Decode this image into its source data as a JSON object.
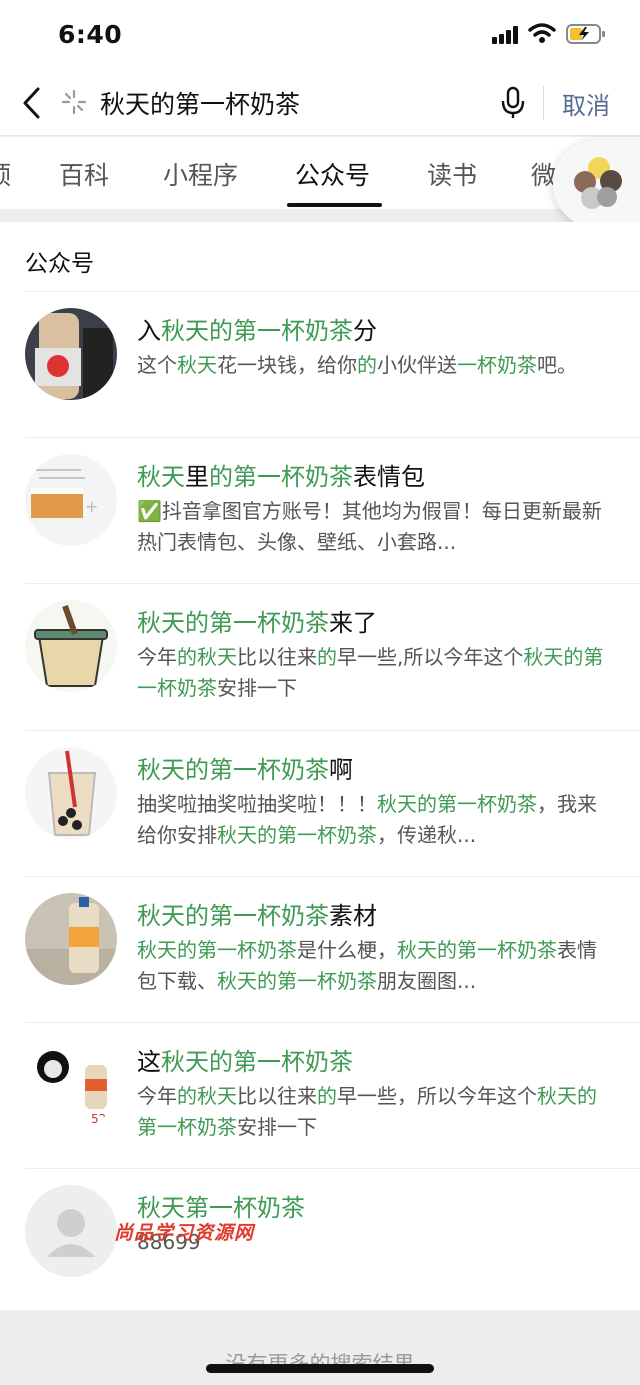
{
  "status": {
    "time": "6:40"
  },
  "search": {
    "query": "秋天的第一杯奶茶",
    "cancel": "取消"
  },
  "tabs": [
    "顶",
    "百科",
    "小程序",
    "公众号",
    "读书",
    "微"
  ],
  "active_tab": "公众号",
  "section_title": "公众号",
  "results": [
    {
      "title": [
        [
          "入",
          0
        ],
        [
          "秋天的第一杯奶茶",
          1
        ],
        [
          "分",
          0
        ]
      ],
      "desc": [
        [
          "这个",
          0
        ],
        [
          "秋天",
          1
        ],
        [
          "花一块钱，给你",
          0
        ],
        [
          "的",
          1
        ],
        [
          "小伙伴送",
          0
        ],
        [
          "一杯奶茶",
          1
        ],
        [
          "吧。",
          0
        ]
      ]
    },
    {
      "title": [
        [
          "秋天",
          1
        ],
        [
          "里",
          0
        ],
        [
          "的第一杯奶茶",
          1
        ],
        [
          "表情包",
          0
        ]
      ],
      "desc": [
        [
          "✅抖音拿图官方账号！其他均为假冒！每日更新最新热门表情包、头像、壁纸、小套路...",
          0
        ]
      ]
    },
    {
      "title": [
        [
          "秋天的第一杯奶茶",
          1
        ],
        [
          "来了",
          0
        ]
      ],
      "desc": [
        [
          "今年",
          0
        ],
        [
          "的",
          1
        ],
        [
          "秋天",
          1
        ],
        [
          "比以往来",
          0
        ],
        [
          "的",
          1
        ],
        [
          "早一些,所以今年这个",
          0
        ],
        [
          "秋天的第一杯奶茶",
          1
        ],
        [
          "安排一下",
          0
        ]
      ]
    },
    {
      "title": [
        [
          "秋天的第一杯奶茶",
          1
        ],
        [
          "啊",
          0
        ]
      ],
      "desc": [
        [
          "抽奖啦抽奖啦抽奖啦！！！",
          0
        ],
        [
          "秋天的第一杯奶茶",
          1
        ],
        [
          "，我来给你安排",
          0
        ],
        [
          "秋天的第一杯奶茶",
          1
        ],
        [
          "，传递秋...",
          0
        ]
      ]
    },
    {
      "title": [
        [
          "秋天的第一杯奶茶",
          1
        ],
        [
          "素材",
          0
        ]
      ],
      "desc": [
        [
          "秋天的第一杯奶茶",
          1
        ],
        [
          "是什么梗，",
          0
        ],
        [
          "秋天的第一杯奶茶",
          1
        ],
        [
          "表情包下载、",
          0
        ],
        [
          "秋天的第一杯奶茶",
          1
        ],
        [
          "朋友圈图...",
          0
        ]
      ]
    },
    {
      "title": [
        [
          "这",
          0
        ],
        [
          "秋天的第一杯奶茶",
          1
        ]
      ],
      "desc": [
        [
          "今年",
          0
        ],
        [
          "的",
          1
        ],
        [
          "秋天",
          1
        ],
        [
          "比以往来",
          0
        ],
        [
          "的",
          1
        ],
        [
          "早一些，所以今年这个",
          0
        ],
        [
          "秋天的第一杯奶茶",
          1
        ],
        [
          "安排一下",
          0
        ]
      ]
    },
    {
      "title": [
        [
          "秋天第一杯奶茶",
          1
        ]
      ],
      "desc": [
        [
          "88699",
          0
        ]
      ]
    }
  ],
  "watermark": "尚品学习资源网",
  "footer": "没有更多的搜索结果",
  "colors": {
    "highlight": "#3f9a54",
    "link": "#576b95"
  }
}
